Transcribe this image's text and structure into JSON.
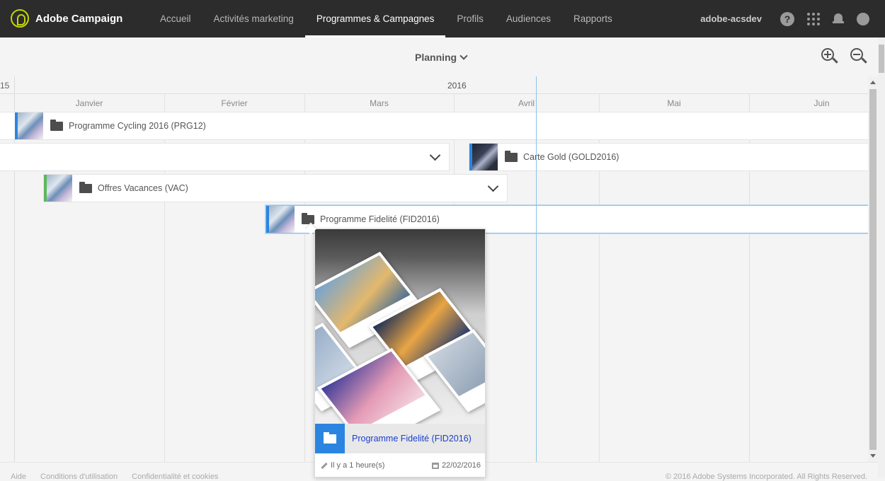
{
  "app": {
    "name": "Adobe Campaign",
    "accent": "#c4d600"
  },
  "nav": [
    {
      "label": "Accueil",
      "active": false
    },
    {
      "label": "Activités marketing",
      "active": false
    },
    {
      "label": "Programmes & Campagnes",
      "active": true
    },
    {
      "label": "Profils",
      "active": false
    },
    {
      "label": "Audiences",
      "active": false
    },
    {
      "label": "Rapports",
      "active": false
    }
  ],
  "user": {
    "name": "adobe-acsdev"
  },
  "toolbar": {
    "view": "Planning"
  },
  "timeline": {
    "year_prev": "15",
    "year": "2016",
    "months": [
      "Janvier",
      "Février",
      "Mars",
      "Avril",
      "Mai",
      "Juin"
    ]
  },
  "programs": [
    {
      "label": "Programme Cycling 2016 (PRG12)",
      "stripe": "#2b85e0"
    },
    {
      "label": "",
      "stripe": "#2b85e0"
    },
    {
      "label": "Carte Gold (GOLD2016)",
      "stripe": "#2b85e0"
    },
    {
      "label": "Offres Vacances (VAC)",
      "stripe": "#5cb85c"
    },
    {
      "label": "Programme Fidelité (FID2016)",
      "stripe": "#2b85e0"
    }
  ],
  "card": {
    "title": "Programme Fidelité (FID2016)",
    "modified": "Il y a 1 heure(s)",
    "date": "22/02/2016"
  },
  "footer": {
    "links": [
      "Aide",
      "Conditions d'utilisation",
      "Confidentialité et cookies"
    ],
    "copyright": "© 2016 Adobe Systems Incorporated. All Rights Reserved."
  }
}
